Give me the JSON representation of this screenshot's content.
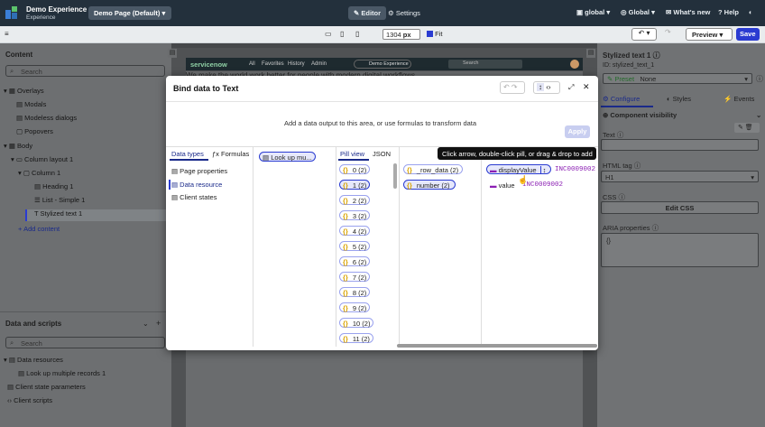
{
  "top": {
    "app": "Demo Experience",
    "sub": "Experience",
    "page": "Demo Page (Default)",
    "editor": "Editor",
    "settings": "Settings",
    "global1": "global",
    "global2": "Global",
    "whatsnew": "What's new",
    "help": "Help"
  },
  "toolbar": {
    "width": "1304",
    "unit": "px",
    "fit": "Fit",
    "preview": "Preview",
    "save": "Save"
  },
  "content": {
    "title": "Content",
    "search": "Search",
    "tree": [
      "Overlays",
      "Modals",
      "Modeless dialogs",
      "Popovers",
      "Body",
      "Column layout 1",
      "Column 1",
      "Heading 1",
      "List - Simple 1",
      "Stylized text 1"
    ],
    "add": "Add content"
  },
  "scripts": {
    "title": "Data and scripts",
    "search": "Search",
    "tree": [
      "Data resources",
      "Look up multiple records 1",
      "Client state parameters",
      "Client scripts"
    ]
  },
  "props": {
    "title": "Stylized text 1",
    "id": "ID: stylized_text_1",
    "preset": "Preset",
    "presetval": "None",
    "tabs": [
      "Configure",
      "Styles",
      "Events"
    ],
    "vis": "Component visibility",
    "text": "Text",
    "htmltag": "HTML tag",
    "tagval": "H1",
    "css": "CSS",
    "editcss": "Edit CSS",
    "aria": "ARIA properties",
    "ariaval": "{}"
  },
  "header": {
    "brand": "servicenow",
    "nav": [
      "All",
      "Favorites",
      "History",
      "Admin"
    ],
    "exp": "Demo Experience",
    "search": "Search"
  },
  "modal": {
    "title": "Bind data to Text",
    "hint": "Add a data output to this area, or use formulas to transform data",
    "apply": "Apply",
    "tabs": [
      "Data types",
      "Formulas"
    ],
    "types": [
      "Page properties",
      "Data resource",
      "Client states"
    ],
    "chip": "Look up mu...",
    "views": [
      "Pill view",
      "JSON"
    ],
    "indices": [
      "0 (2)",
      "1 (2)",
      "2 (2)",
      "3 (2)",
      "4 (2)",
      "5 (2)",
      "6 (2)",
      "7 (2)",
      "8 (2)",
      "9 (2)",
      "10 (2)",
      "11 (2)"
    ],
    "fields": [
      "_row_data (2)",
      "number (2)"
    ],
    "props": [
      "displayValue",
      "value"
    ],
    "vals": [
      "INC0009002",
      "INC0009002"
    ]
  },
  "tooltip": "Click arrow, double-click pill, or drag & drop to add",
  "behind": "We make the world work better for people with modern digital workflows"
}
